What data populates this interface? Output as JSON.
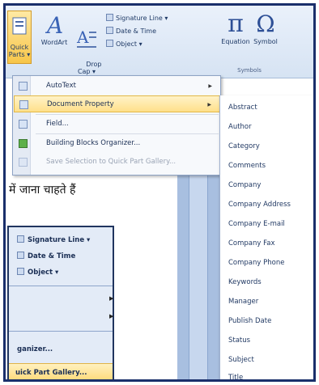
{
  "ribbon": {
    "quick_parts_label": "Quick\nParts ▾",
    "wordart_label": "WordArt",
    "dropcap_label": "Drop\nCap ▾",
    "signature_line_label": "Signature Line ▾",
    "date_time_label": "Date & Time",
    "object_label": "Object ▾",
    "equation_label": "Equation",
    "symbol_label": "Symbol",
    "symbols_group_label": "Symbols",
    "pi_glyph": "π",
    "omega_glyph": "Ω"
  },
  "menu": {
    "items": [
      {
        "label": "AutoText",
        "has_submenu": true
      },
      {
        "label": "Document Property",
        "has_submenu": true,
        "highlighted": true
      },
      {
        "label": "Field..."
      },
      {
        "label": "Building Blocks Organizer..."
      },
      {
        "label": "Save Selection to Quick Part Gallery...",
        "disabled": true
      }
    ]
  },
  "submenu": {
    "items": [
      "Abstract",
      "Author",
      "Category",
      "Comments",
      "Company",
      "Company Address",
      "Company E-mail",
      "Company Fax",
      "Company Phone",
      "Keywords",
      "Manager",
      "Publish Date",
      "Status",
      "Subject",
      "Title"
    ]
  },
  "document": {
    "hindi_text": "में जाना चाहते हैं"
  },
  "panel": {
    "signature_line": "Signature Line ▾",
    "date_time": "Date & Time",
    "object": "Object ▾",
    "organizer": "ganizer...",
    "gallery": "uick Part Gallery..."
  },
  "colors": {
    "frame": "#1a2f6b",
    "highlight": "#ffe08a",
    "ribbon": "#d6e3f3"
  }
}
